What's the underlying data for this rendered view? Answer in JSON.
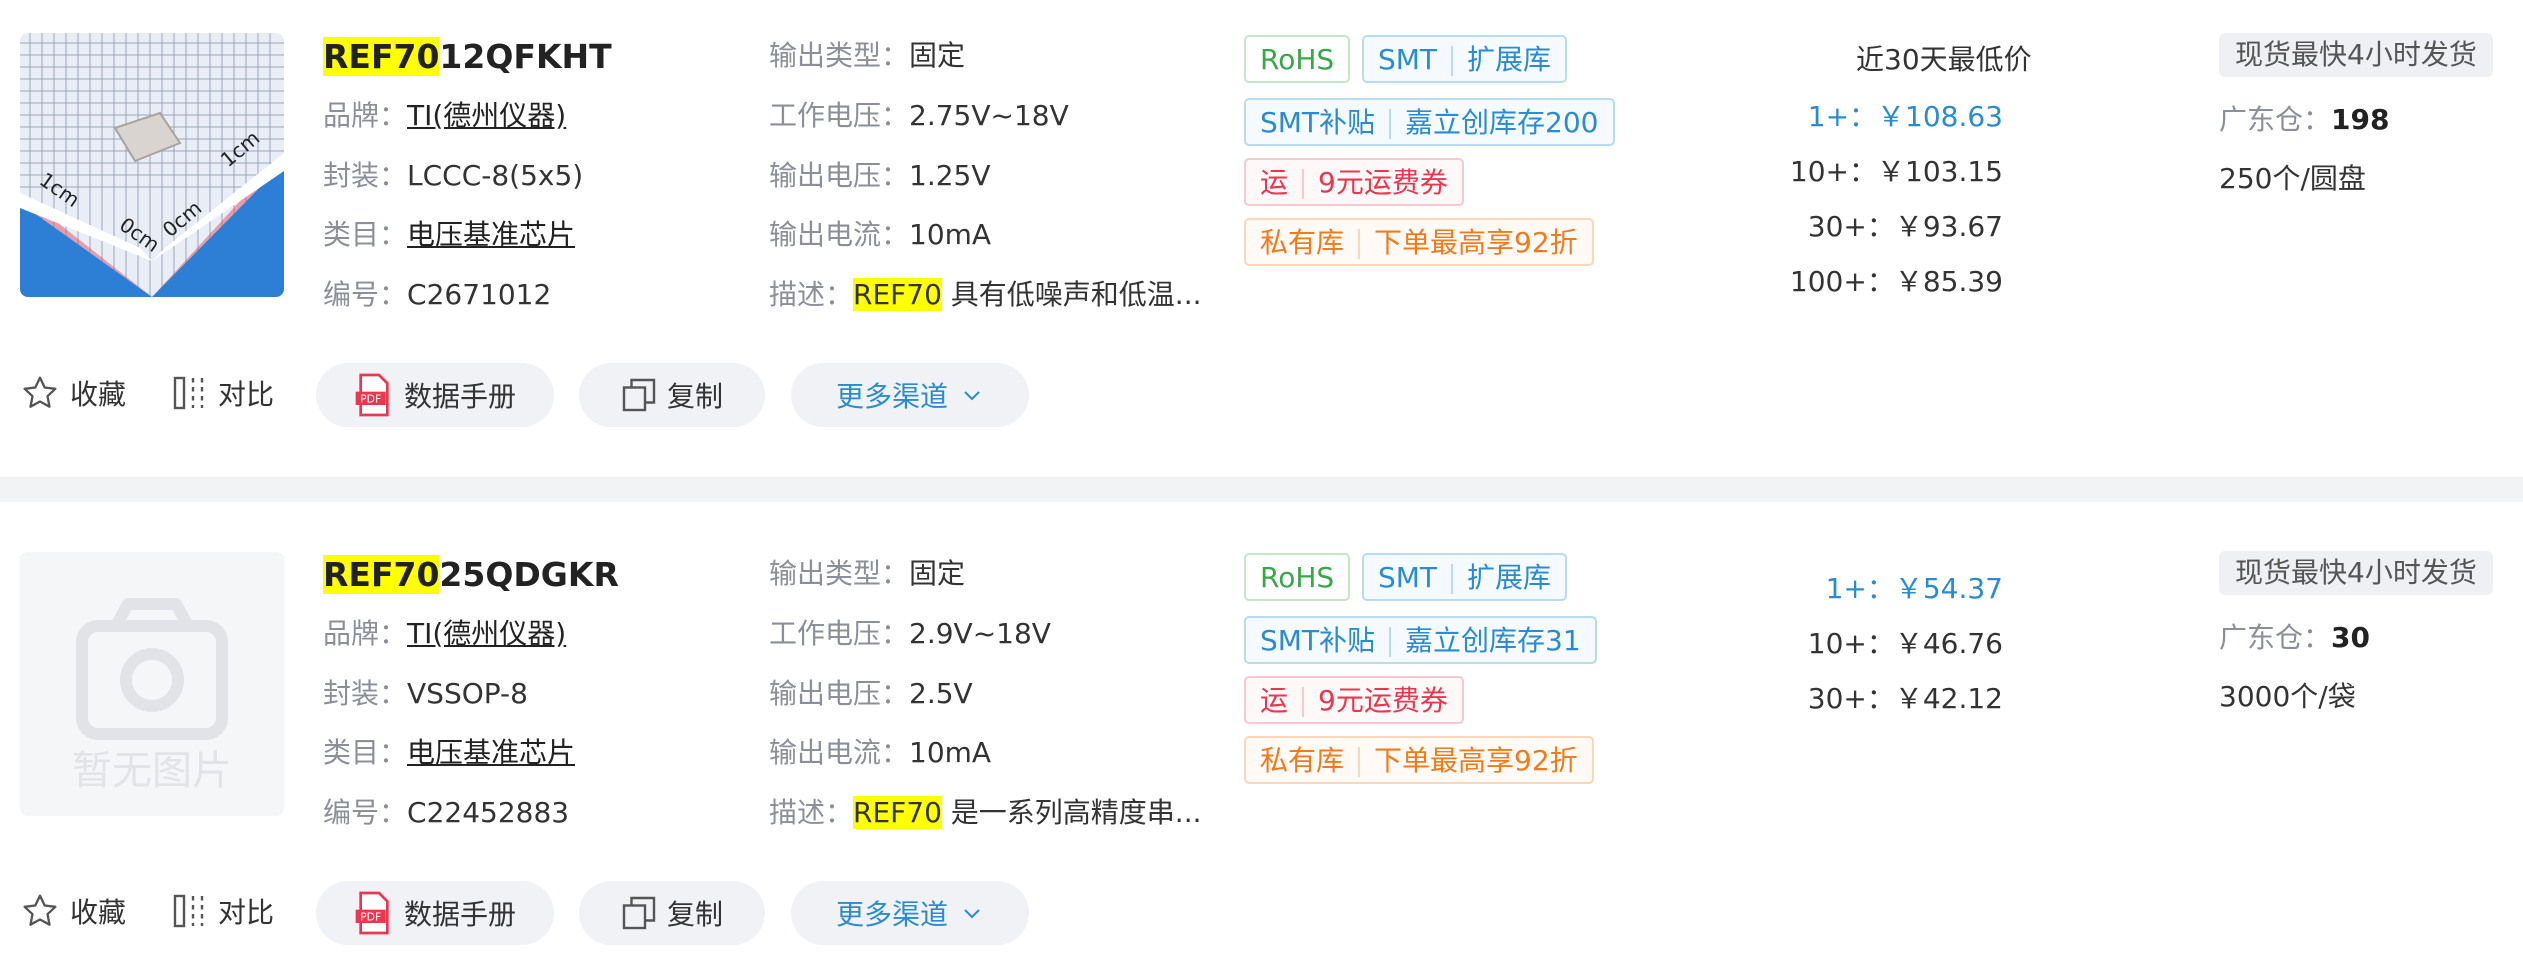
{
  "products": [
    {
      "name_hl": "REF70",
      "name_rest": "12QFKHT",
      "brand_label": "品牌：",
      "brand": "TI(德州仪器)",
      "package_label": "封装：",
      "package": "LCCC-8(5x5)",
      "category_label": "类目：",
      "category": "电压基准芯片",
      "code_label": "编号：",
      "code": "C2671012",
      "output_type_label": "输出类型：",
      "output_type": "固定",
      "voltage_label": "工作电压：",
      "voltage": "2.75V~18V",
      "out_voltage_label": "输出电压：",
      "out_voltage": "1.25V",
      "out_current_label": "输出电流：",
      "out_current": "10mA",
      "desc_label": "描述：",
      "desc_hl": "REF70",
      "desc": " 具有低噪声和低温...",
      "tags": {
        "rohs": "RoHS",
        "smt": "SMT",
        "ext": "扩展库",
        "smt_sub": "SMT补贴",
        "stock_tag": "嘉立创库存200",
        "ship": "运",
        "coupon": "9元运费券",
        "private": "私有库",
        "discount": "下单最高享92折"
      },
      "price_title": "近30天最低价",
      "prices": [
        "1+：￥108.63",
        "10+：￥103.15",
        "30+：￥93.67",
        "100+：￥85.39"
      ],
      "fast_ship": "现货最快4小时发货",
      "warehouse_label": "广东仓：",
      "warehouse_qty": "198",
      "pack": "250个/圆盘",
      "image_label": ""
    },
    {
      "name_hl": "REF70",
      "name_rest": "25QDGKR",
      "brand_label": "品牌：",
      "brand": "TI(德州仪器)",
      "package_label": "封装：",
      "package": "VSSOP-8",
      "category_label": "类目：",
      "category": "电压基准芯片",
      "code_label": "编号：",
      "code": "C22452883",
      "output_type_label": "输出类型：",
      "output_type": "固定",
      "voltage_label": "工作电压：",
      "voltage": "2.9V~18V",
      "out_voltage_label": "输出电压：",
      "out_voltage": "2.5V",
      "out_current_label": "输出电流：",
      "out_current": "10mA",
      "desc_label": "描述：",
      "desc_hl": "REF70",
      "desc": " 是一系列高精度串...",
      "tags": {
        "rohs": "RoHS",
        "smt": "SMT",
        "ext": "扩展库",
        "smt_sub": "SMT补贴",
        "stock_tag": "嘉立创库存31",
        "ship": "运",
        "coupon": "9元运费券",
        "private": "私有库",
        "discount": "下单最高享92折"
      },
      "price_title": "",
      "prices": [
        "1+：￥54.37",
        "10+：￥46.76",
        "30+：￥42.12"
      ],
      "fast_ship": "现货最快4小时发货",
      "warehouse_label": "广东仓：",
      "warehouse_qty": "30",
      "pack": "3000个/袋",
      "image_label": "暂无图片"
    }
  ],
  "actions": {
    "favorite": "收藏",
    "compare": "对比",
    "datasheet": "数据手册",
    "copy": "复制",
    "more": "更多渠道"
  },
  "colors": {
    "accent": "#2a8bd0",
    "highlight": "#ffff00",
    "green": "#3aa64a",
    "red": "#e8374f",
    "orange": "#f07b1d"
  }
}
